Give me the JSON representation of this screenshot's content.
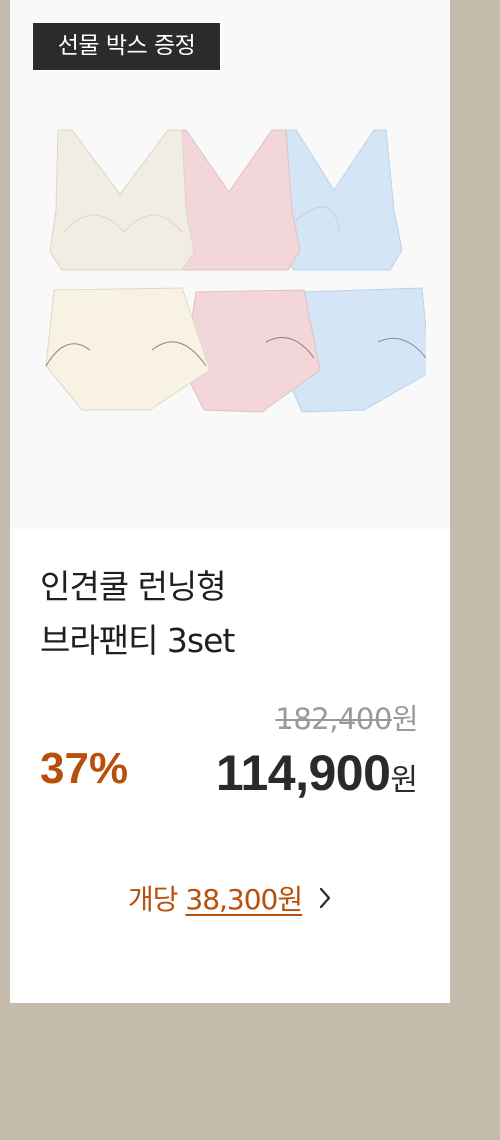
{
  "badge": {
    "label": "선물 박스 증정"
  },
  "product": {
    "title_line1": "인견쿨 런닝형",
    "title_line2": "브라팬티 3set",
    "image_icon": "bra-panty-set-image",
    "colors": [
      "#f1ede2",
      "#f3d6da",
      "#d4e6f6"
    ]
  },
  "price": {
    "original": "182,400",
    "original_unit": "원",
    "discount": "37%",
    "sale": "114,900",
    "sale_unit": "원"
  },
  "unit_price": {
    "prefix": "개당",
    "amount": "38,300원",
    "icon": "chevron-right-icon"
  },
  "colors": {
    "background": "#c6bcab",
    "accent": "#b8500d",
    "badge_bg": "#2b2b2b"
  }
}
